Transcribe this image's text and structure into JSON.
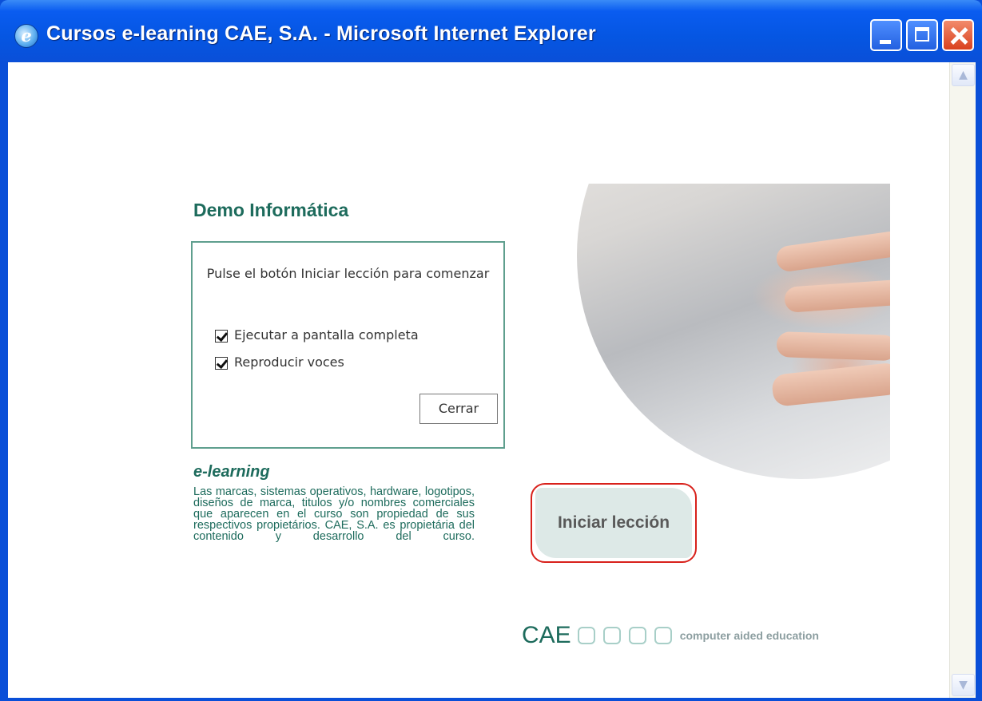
{
  "window": {
    "title": "Cursos e-learning CAE, S.A. - Microsoft Internet Explorer",
    "icon": "internet-explorer-icon",
    "controls": [
      "minimize-icon",
      "maximize-icon",
      "close-icon"
    ]
  },
  "lesson": {
    "title": "Demo Informática",
    "dialog": {
      "message": "Pulse el botón Iniciar lección para comenzar",
      "options": [
        {
          "label": "Ejecutar a pantalla completa",
          "checked": true
        },
        {
          "label": "Reproducir voces",
          "checked": true
        }
      ],
      "close_label": "Cerrar"
    },
    "elearning_heading": "e-learning",
    "disclaimer": "Las marcas, sistemas operativos, hardware, logotipos, diseños de marca, titulos y/o nombres comerciales que aparecen en el curso son propiedad de sus respectivos propietários. CAE, S.A. es propietária del contenido y desarrollo del curso.",
    "start_label": "Iniciar lección",
    "footer": {
      "brand": "CAE",
      "tagline": "computer aided education"
    }
  },
  "colors": {
    "accent_green": "#1d6b5c",
    "titlebar_blue": "#0a4fd8",
    "highlight_red": "#d8211b",
    "button_fill": "#dde9e7"
  }
}
